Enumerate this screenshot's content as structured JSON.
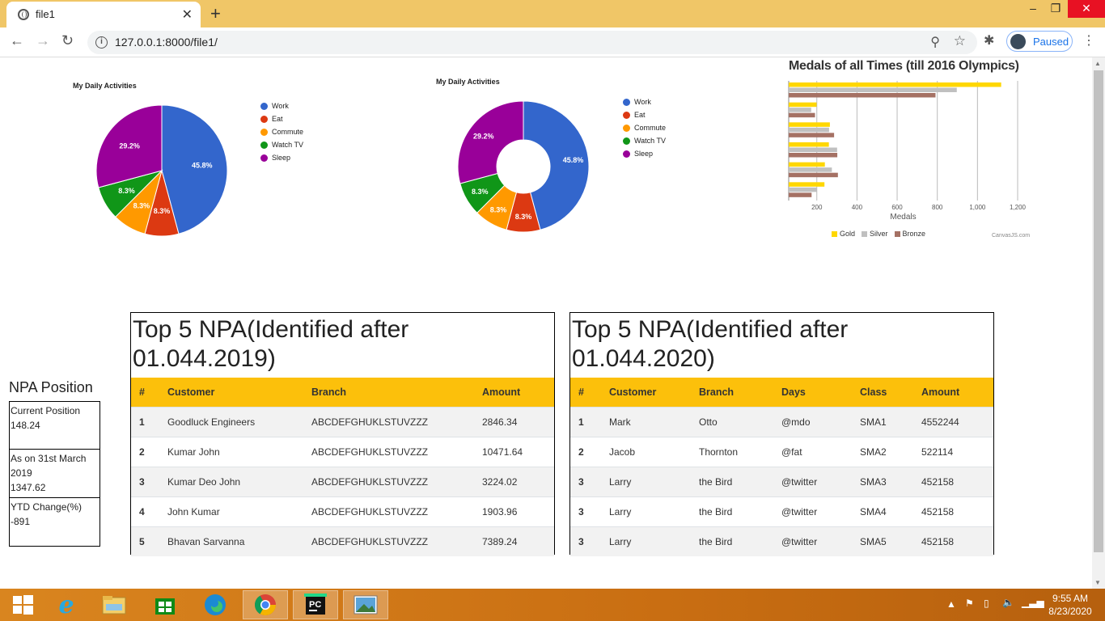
{
  "browser": {
    "tab_title": "file1",
    "url": "127.0.0.1:8000/file1/",
    "profile_label": "Paused"
  },
  "charts": {
    "pie": {
      "title": "My Daily Activities",
      "legend": [
        "Work",
        "Eat",
        "Commute",
        "Watch TV",
        "Sleep"
      ]
    },
    "donut": {
      "title": "My Daily Activities",
      "legend": [
        "Work",
        "Eat",
        "Commute",
        "Watch TV",
        "Sleep"
      ]
    },
    "medals": {
      "title": "Medals of all Times (till 2016 Olympics)",
      "xlabel": "Medals",
      "legend": [
        "Gold",
        "Silver",
        "Bronze"
      ],
      "credit": "CanvasJS.com"
    }
  },
  "chart_data": [
    {
      "type": "pie",
      "title": "My Daily Activities",
      "categories": [
        "Work",
        "Eat",
        "Commute",
        "Watch TV",
        "Sleep"
      ],
      "values": [
        11,
        2,
        2,
        2,
        7
      ],
      "labels": [
        "45.8%",
        "8.3%",
        "8.3%",
        "8.3%",
        "29.2%"
      ],
      "colors": [
        "#3366cc",
        "#dc3912",
        "#ff9900",
        "#109618",
        "#990099"
      ],
      "legend_position": "right"
    },
    {
      "type": "pie",
      "donut": true,
      "title": "My Daily Activities",
      "categories": [
        "Work",
        "Eat",
        "Commute",
        "Watch TV",
        "Sleep"
      ],
      "values": [
        11,
        2,
        2,
        2,
        7
      ],
      "labels": [
        "45.8%",
        "8.3%",
        "8.3%",
        "8.3%",
        "29.2%"
      ],
      "colors": [
        "#3366cc",
        "#dc3912",
        "#ff9900",
        "#109618",
        "#990099"
      ],
      "legend_position": "right"
    },
    {
      "type": "bar",
      "orientation": "horizontal",
      "title": "Medals of all Times (till 2016 Olympics)",
      "xlabel": "Medals",
      "xlim": [
        60,
        1200
      ],
      "xticks": [
        200,
        400,
        600,
        800,
        1000,
        1200
      ],
      "xtick_labels": [
        "200",
        "400",
        "600",
        "800",
        "1,000",
        "1,200"
      ],
      "grid": true,
      "legend_position": "bottom",
      "series": [
        {
          "name": "Gold",
          "color": "#ffd700",
          "values": [
            1118,
            199,
            265,
            260,
            240,
            238
          ]
        },
        {
          "name": "Silver",
          "color": "#c0c0c0",
          "values": [
            897,
            172,
            261,
            301,
            275,
            199
          ]
        },
        {
          "name": "Bronze",
          "color": "#a57164",
          "values": [
            791,
            191,
            286,
            302,
            305,
            174
          ]
        }
      ]
    }
  ],
  "npa_position": {
    "title": "NPA Position",
    "boxes": [
      {
        "label": "Current Position",
        "value": "148.24"
      },
      {
        "label": "As on 31st March 2019",
        "value": "1347.62"
      },
      {
        "label": "YTD Change(%)",
        "value": "-891"
      }
    ]
  },
  "table1": {
    "title": "Top 5 NPA(Identified after 01.044.2019)",
    "headers": [
      "#",
      "Customer",
      "Branch",
      "Amount"
    ],
    "rows": [
      [
        "1",
        "Goodluck Engineers",
        "ABCDEFGHUKLSTUVZZZ",
        "2846.34"
      ],
      [
        "2",
        "Kumar John",
        "ABCDEFGHUKLSTUVZZZ",
        "10471.64"
      ],
      [
        "3",
        "Kumar Deo John",
        "ABCDEFGHUKLSTUVZZZ",
        "3224.02"
      ],
      [
        "4",
        "John Kumar",
        "ABCDEFGHUKLSTUVZZZ",
        "1903.96"
      ],
      [
        "5",
        "Bhavan Sarvanna",
        "ABCDEFGHUKLSTUVZZZ",
        "7389.24"
      ]
    ]
  },
  "table2": {
    "title": "Top 5 NPA(Identified after 01.044.2020)",
    "headers": [
      "#",
      "Customer",
      "Branch",
      "Days",
      "Class",
      "Amount"
    ],
    "rows": [
      [
        "1",
        "Mark",
        "Otto",
        "@mdo",
        "SMA1",
        "4552244"
      ],
      [
        "2",
        "Jacob",
        "Thornton",
        "@fat",
        "SMA2",
        "522114"
      ],
      [
        "3",
        "Larry",
        "the Bird",
        "@twitter",
        "SMA3",
        "452158"
      ],
      [
        "3",
        "Larry",
        "the Bird",
        "@twitter",
        "SMA4",
        "452158"
      ],
      [
        "3",
        "Larry",
        "the Bird",
        "@twitter",
        "SMA5",
        "452158"
      ]
    ]
  },
  "taskbar": {
    "time": "9:55 AM",
    "date": "8/23/2020"
  }
}
